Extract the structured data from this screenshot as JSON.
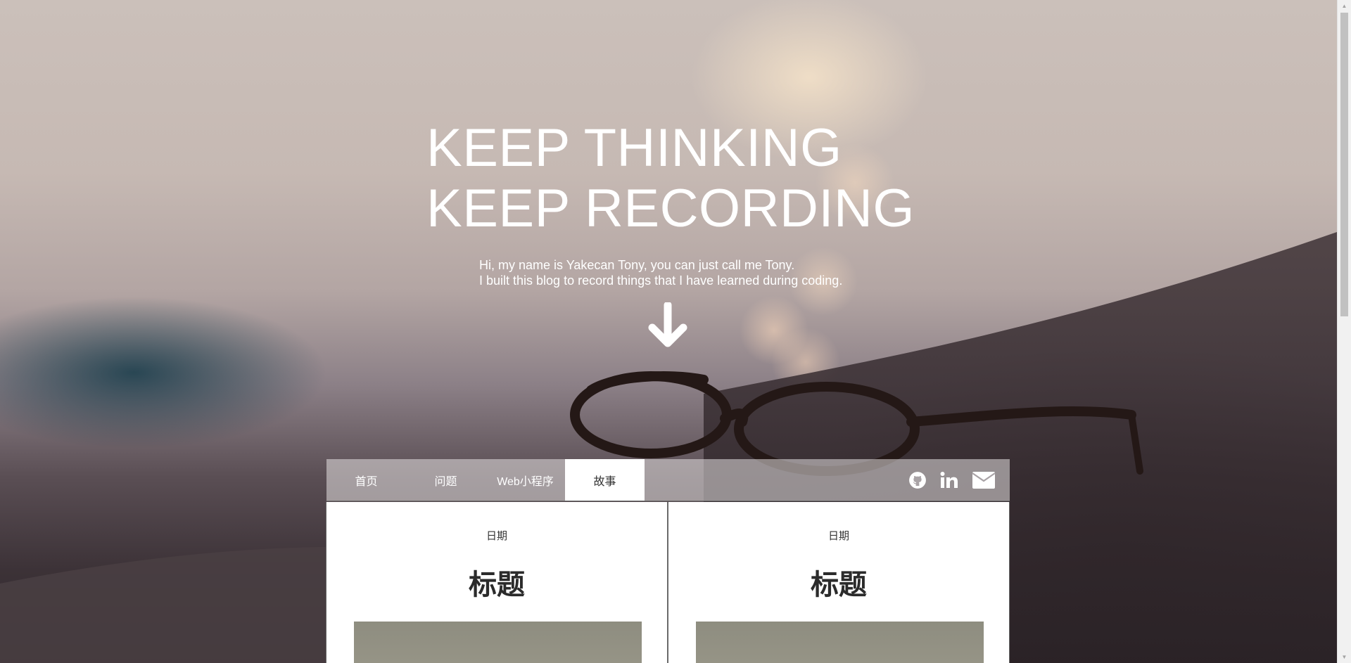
{
  "hero": {
    "title_line1": "KEEP THINKING",
    "title_line2": "KEEP RECORDING",
    "intro_line1": "Hi, my name is Yakecan Tony, you can just call me Tony.",
    "intro_line2": "I built this blog to record things that I have learned during coding.",
    "scroll_icon": "arrow-down-icon"
  },
  "nav": {
    "tabs": [
      {
        "label": "首页",
        "active": false
      },
      {
        "label": "问题",
        "active": false
      },
      {
        "label": "Web小程序",
        "active": false
      },
      {
        "label": "故事",
        "active": true
      }
    ],
    "social": [
      "github-icon",
      "linkedin-icon",
      "envelope-icon"
    ]
  },
  "cards": [
    {
      "date": "日期",
      "title": "标题"
    },
    {
      "date": "日期",
      "title": "标题"
    }
  ],
  "colors": {
    "nav_active_bg": "#ffffff",
    "text_light": "#ffffff",
    "text_dark": "#333333"
  }
}
